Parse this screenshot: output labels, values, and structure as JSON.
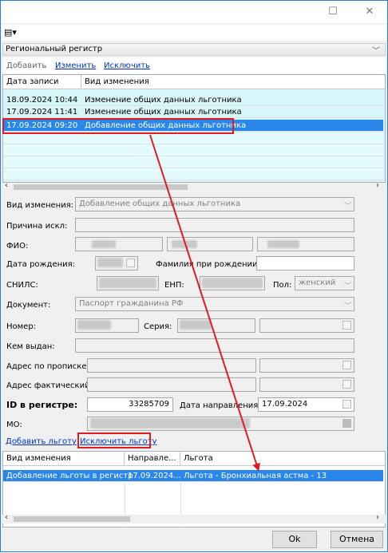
{
  "window": {
    "minimize_glyph": "☐",
    "close_glyph": "✕"
  },
  "toolbar": {
    "menu_icon": "▤▾"
  },
  "section": {
    "title": "Региональный регистр",
    "chevron": "﹀"
  },
  "actions": {
    "add": "Добавить",
    "edit": "Изменить",
    "exclude": "Исключить"
  },
  "history_table": {
    "columns": [
      "Дата записи",
      "Вид изменения"
    ],
    "rows": [
      [
        "18.09.2024 10:44",
        "Изменение общих данных льготника"
      ],
      [
        "17.09.2024 11:41",
        "Изменение общих данных льготника"
      ],
      [
        "17.09.2024 09:20",
        "Добавление общих данных льготника"
      ]
    ],
    "selected_index": 2
  },
  "form": {
    "change_type_label": "Вид изменения:",
    "change_type_value": "Добавление общих данных льготника",
    "reason_label": "Причина искл:",
    "fio_label": "ФИО:",
    "birth_label": "Дата рождения:",
    "maiden_label": "Фамилия при рождении:",
    "snils_label": "СНИЛС:",
    "enp_label": "ЕНП:",
    "sex_label": "Пол:",
    "sex_value": "женский",
    "doc_label": "Документ:",
    "doc_value": "Паспорт гражданина РФ",
    "number_label": "Номер:",
    "series_label": "Серия:",
    "issued_label": "Кем выдан:",
    "reg_addr_label": "Адрес по прописке:",
    "fact_addr_label": "Адрес фактический",
    "id_label": "ID в регистре:",
    "id_value": "33285709",
    "referral_label": "Дата направления:",
    "referral_value": "17.09.2024",
    "mo_label": "МО:"
  },
  "benefit_actions": {
    "add": "Добавить льготу",
    "exclude": "Исключить льготу"
  },
  "benefits_table": {
    "columns": [
      "Вид изменения",
      "Направле...",
      "Льгота"
    ],
    "rows": [
      [
        "Добавление льготы в регистр",
        "17.09.2024...",
        "Льгота - Бронхиальная астма - 13"
      ]
    ]
  },
  "buttons": {
    "ok": "Ok",
    "cancel": "Отмена"
  },
  "colors": {
    "accent": "#2a86e8",
    "annotation": "#e11b22",
    "grid_bg": "#d6f6f9"
  }
}
